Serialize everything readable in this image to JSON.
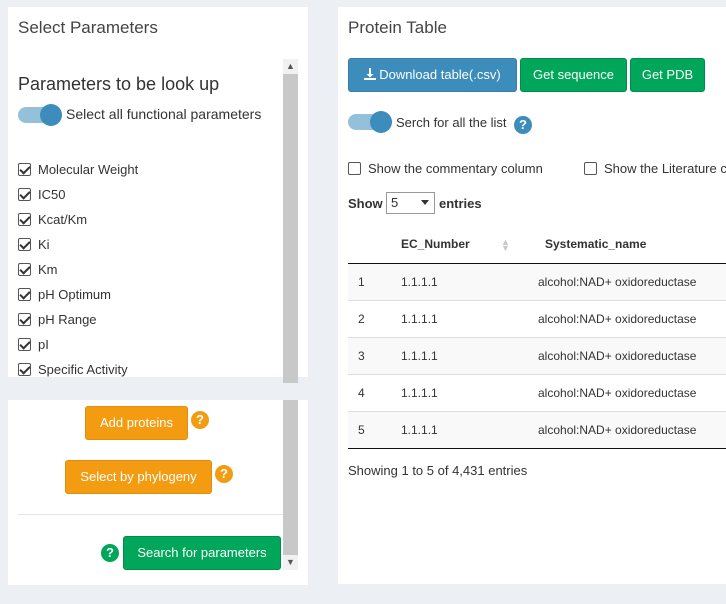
{
  "left_panel": {
    "title": "Select Parameters",
    "subheading": "Parameters to be look up",
    "select_all_label": "Select all functional parameters",
    "parameters": [
      {
        "label": "Molecular Weight",
        "checked": true
      },
      {
        "label": "IC50",
        "checked": true
      },
      {
        "label": "Kcat/Km",
        "checked": true
      },
      {
        "label": "Ki",
        "checked": true
      },
      {
        "label": "Km",
        "checked": true
      },
      {
        "label": "pH Optimum",
        "checked": true
      },
      {
        "label": "pH Range",
        "checked": true
      },
      {
        "label": "pI",
        "checked": true
      },
      {
        "label": "Specific Activity",
        "checked": true
      }
    ]
  },
  "actions": {
    "add_proteins": "Add proteins",
    "select_by_phylogeny": "Select by phylogeny",
    "search_for_parameters": "Search for parameters",
    "help_glyph": "?"
  },
  "right_panel": {
    "title": "Protein Table",
    "download_label": "Download table(.csv)",
    "get_sequence_label": "Get sequence",
    "get_pdb_label": "Get PDB",
    "search_all_label": "Serch for all the list",
    "show_commentary_label": "Show the commentary column",
    "show_literature_label": "Show the Literature c",
    "show_label": "Show",
    "entries_value": "5",
    "entries_label": "entries",
    "columns": [
      "",
      "EC_Number",
      "Systematic_name"
    ],
    "rows": [
      [
        "1",
        "1.1.1.1",
        "alcohol:NAD+ oxidoreductase"
      ],
      [
        "2",
        "1.1.1.1",
        "alcohol:NAD+ oxidoreductase"
      ],
      [
        "3",
        "1.1.1.1",
        "alcohol:NAD+ oxidoreductase"
      ],
      [
        "4",
        "1.1.1.1",
        "alcohol:NAD+ oxidoreductase"
      ],
      [
        "5",
        "1.1.1.1",
        "alcohol:NAD+ oxidoreductase"
      ]
    ],
    "footer": "Showing 1 to 5 of 4,431 entries"
  },
  "colors": {
    "primary": "#3c8dbc",
    "success": "#00a65a",
    "warning": "#f39c12",
    "background": "#ecf0f5"
  },
  "icons": {
    "download": "download-icon",
    "help": "question-circle-icon",
    "sort": "sort-icon"
  }
}
